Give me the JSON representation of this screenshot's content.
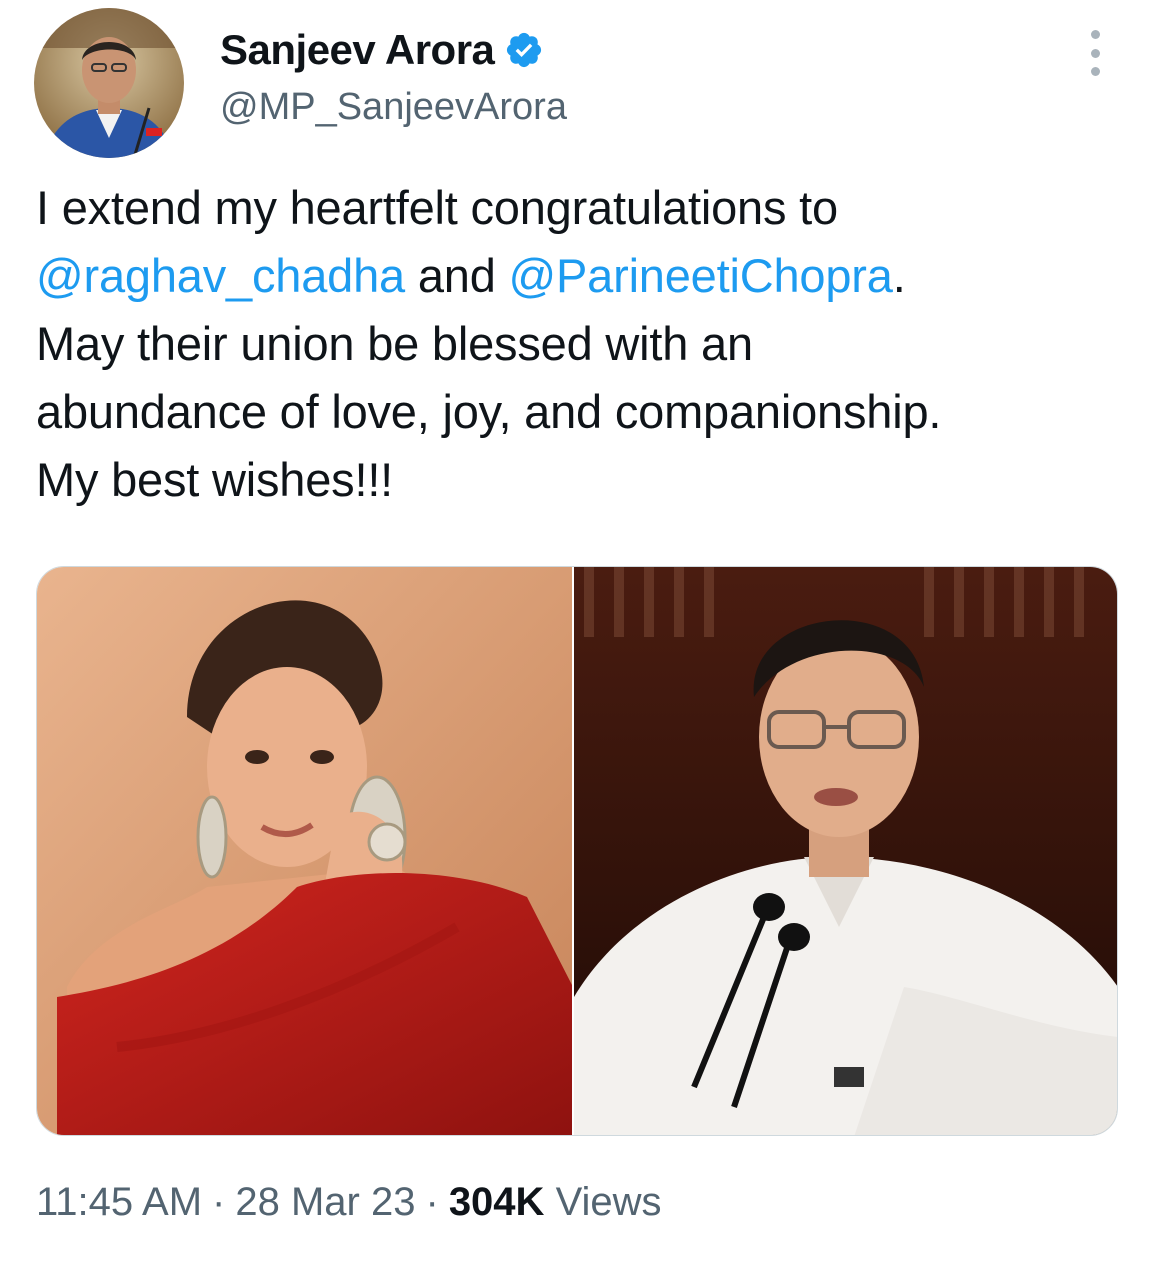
{
  "author": {
    "display_name": "Sanjeev Arora",
    "handle": "@MP_SanjeevArora",
    "verified": true
  },
  "tweet": {
    "text_lines": [
      "I extend my heartfelt congratulations to",
      "May their union be blessed with an",
      "abundance of love, joy, and companionship.",
      "My best wishes!!!"
    ],
    "mention_1": "@raghav_chadha",
    "connector": "and",
    "mention_2": "@ParineetiChopra",
    "line2_end": "."
  },
  "meta": {
    "time": "11:45 AM",
    "separator": "·",
    "date": "28 Mar 23",
    "views_count": "304K",
    "views_label": "Views"
  },
  "icons": {
    "verified": "verified-badge-icon",
    "more": "more-options-icon"
  },
  "colors": {
    "link": "#1d9bf0",
    "text": "#0f1419",
    "secondary": "#536471",
    "verified": "#1d9bf0"
  }
}
